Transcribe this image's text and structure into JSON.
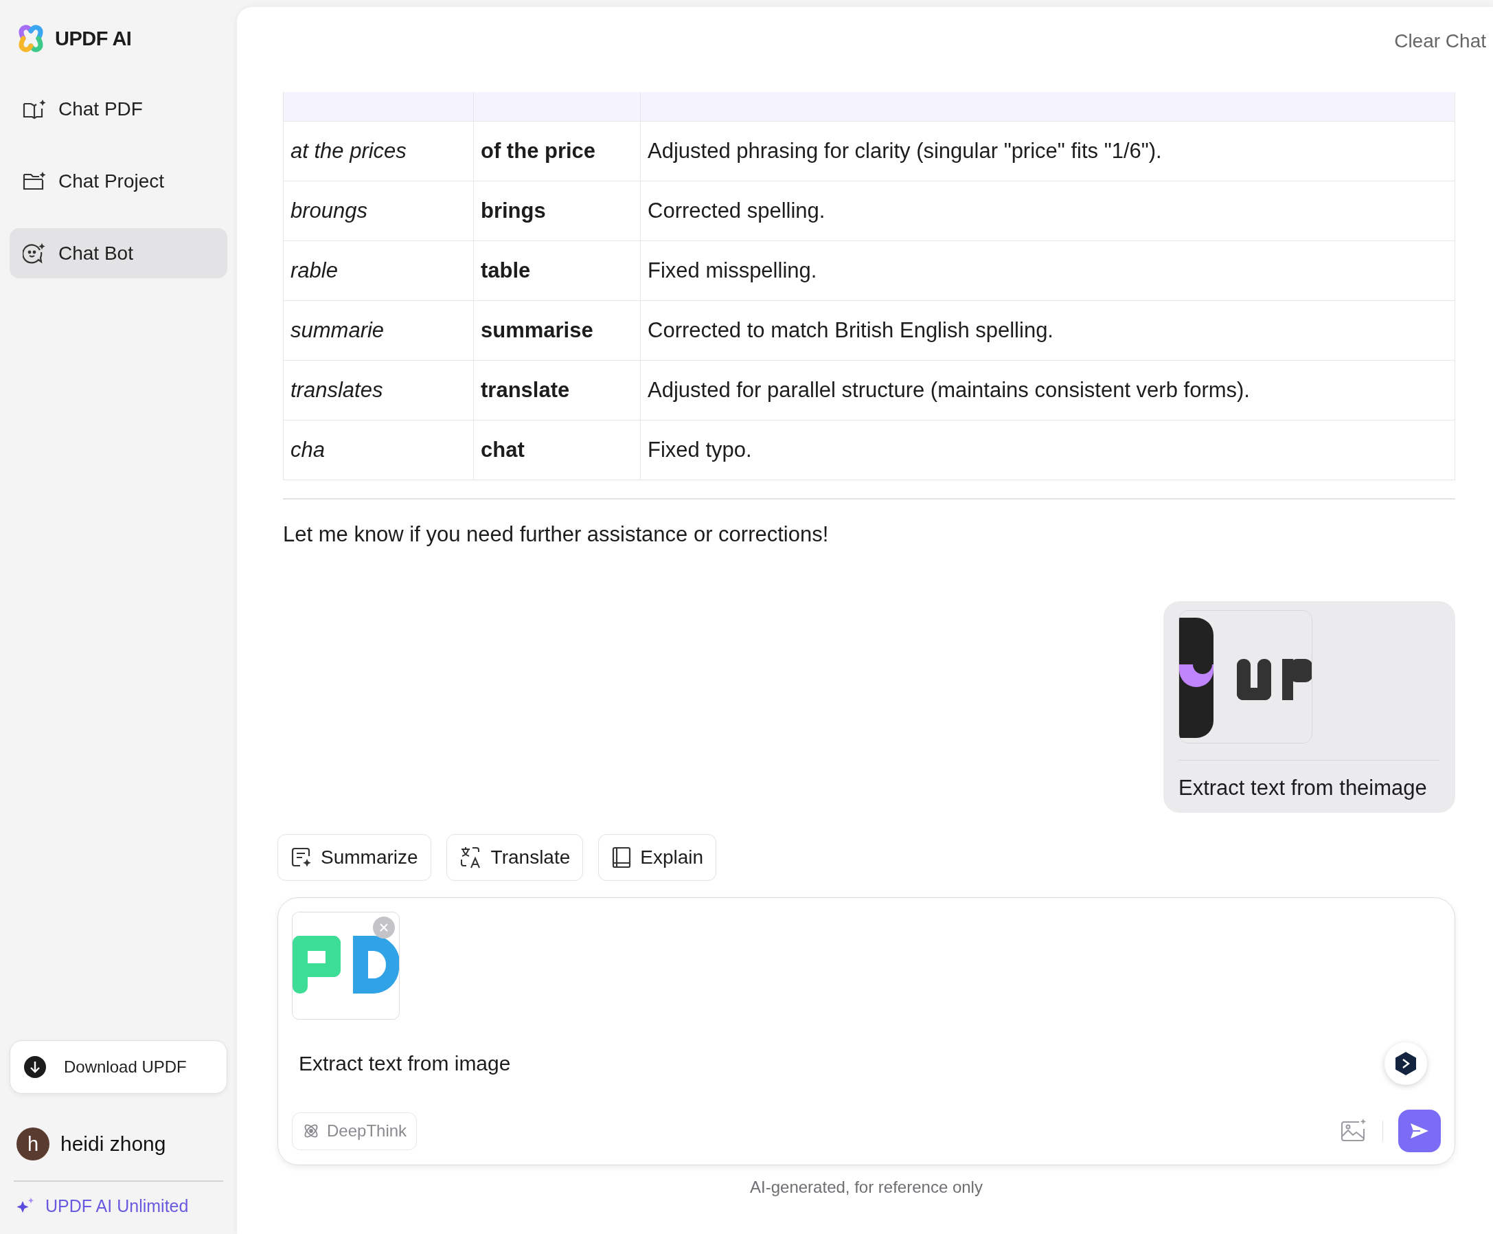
{
  "sidebar": {
    "brand": "UPDF AI",
    "items": [
      {
        "label": "Chat PDF",
        "kind": "book",
        "selected": false
      },
      {
        "label": "Chat Project",
        "kind": "folder",
        "selected": false
      },
      {
        "label": "Chat Bot",
        "kind": "bot",
        "selected": true
      }
    ],
    "download_button": "Download UPDF",
    "user": {
      "avatar_letter": "h",
      "name": "heidi zhong"
    },
    "plan_link": "UPDF AI Unlimited"
  },
  "header": {
    "clear_button": "Clear Chat"
  },
  "table": {
    "rows": [
      {
        "original": "at the prices",
        "correction": "of the price",
        "explanation": "Adjusted phrasing for clarity (singular \"price\" fits \"1/6\")."
      },
      {
        "original": "broungs",
        "correction": "brings",
        "explanation": "Corrected spelling."
      },
      {
        "original": "rable",
        "correction": "table",
        "explanation": "Fixed misspelling."
      },
      {
        "original": "summarie",
        "correction": "summarise",
        "explanation": "Corrected to match British English spelling."
      },
      {
        "original": "translates",
        "correction": "translate",
        "explanation": "Adjusted for parallel structure (maintains consistent verb forms)."
      },
      {
        "original": "cha",
        "correction": "chat",
        "explanation": "Fixed typo."
      }
    ]
  },
  "closing_message": "Let me know if you need further assistance or corrections!",
  "user_message": {
    "text": "Extract text from theimage"
  },
  "quick_actions": [
    {
      "label": "Summarize",
      "kind": "summarize"
    },
    {
      "label": "Translate",
      "kind": "translate"
    },
    {
      "label": "Explain",
      "kind": "explain"
    }
  ],
  "composer": {
    "value": "Extract text from image",
    "deepthink": {
      "label": "DeepThink",
      "on": false
    }
  },
  "footer_note": "AI-generated, for reference only"
}
